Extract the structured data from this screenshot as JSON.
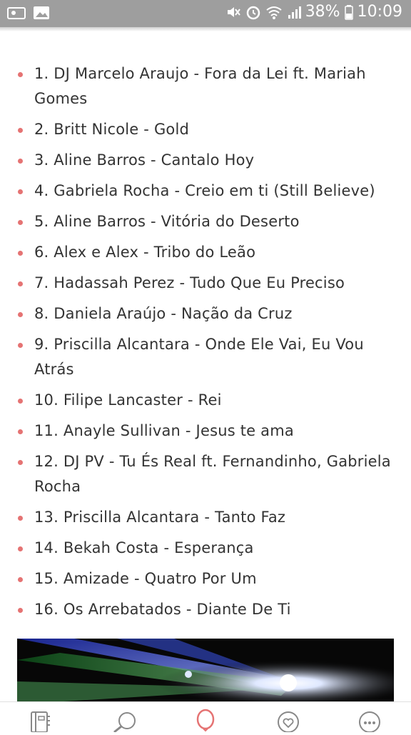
{
  "status_bar": {
    "battery": "38%",
    "time": "10:09"
  },
  "songs": [
    "1. DJ Marcelo Araujo - Fora da Lei ft. Mariah Gomes",
    "2. Britt Nicole - Gold",
    "3. Aline Barros - Cantalo Hoy",
    "4. Gabriela Rocha - Creio em ti (Still Believe)",
    "5. Aline Barros - Vitória do Deserto",
    "6. Alex e Alex - Tribo do Leão",
    "7. Hadassah Perez - Tudo Que Eu Preciso",
    "8. Daniela Araújo - Nação da Cruz",
    "9. Priscilla Alcantara - Onde Ele Vai, Eu Vou Atrás",
    "10. Filipe Lancaster - Rei",
    "11. Anayle Sullivan - Jesus te ama",
    "12. DJ PV - Tu És Real ft. Fernandinho, Gabriela Rocha",
    "13. Priscilla Alcantara - Tanto Faz",
    "14. Bekah Costa - Esperança",
    "15. Amizade -  Quatro Por Um",
    "16. Os Arrebatados - Diante De Ti"
  ],
  "colors": {
    "bullet": "#e57373",
    "accent": "#e57373",
    "status_bar": "#9e9e9e"
  },
  "bottom_nav": [
    {
      "icon": "notebook-icon"
    },
    {
      "icon": "search-icon"
    },
    {
      "icon": "balloon-icon"
    },
    {
      "icon": "heart-chat-icon"
    },
    {
      "icon": "more-icon"
    }
  ]
}
